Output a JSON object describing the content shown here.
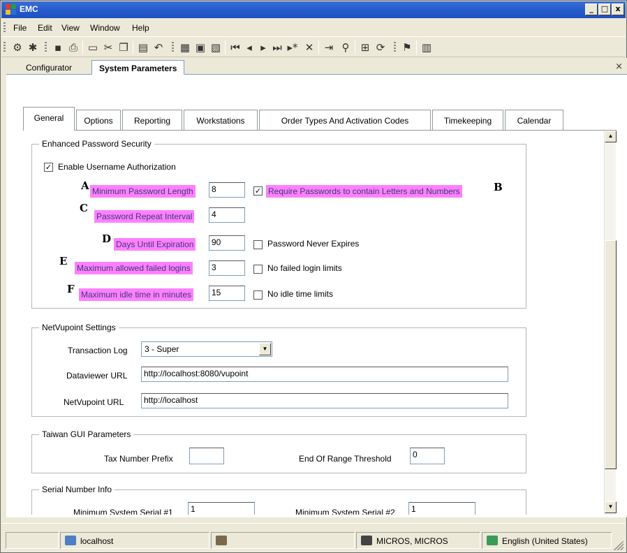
{
  "window": {
    "title": "EMC",
    "minimize": "_",
    "maximize": "□",
    "close": "x"
  },
  "menu": [
    "File",
    "Edit",
    "View",
    "Window",
    "Help"
  ],
  "toolbar_icons": [
    "module-icon",
    "modules-icon",
    "save-icon",
    "print-icon",
    "print-preview-icon",
    "cut-icon",
    "copy-icon",
    "paste-icon",
    "undo-icon",
    "form-view-icon",
    "table-view-icon",
    "duplicate-icon",
    "first-record-icon",
    "previous-record-icon",
    "next-record-icon",
    "last-record-icon",
    "new-record-icon",
    "delete-record-icon",
    "goto-icon",
    "find-icon",
    "tree-icon",
    "refresh-icon",
    "run-icon",
    "properties-icon"
  ],
  "doc_tabs": [
    "Configurator",
    "System Parameters"
  ],
  "doc_close": "×",
  "inner_tabs": [
    "General",
    "Options",
    "Reporting",
    "Workstations",
    "Order Types And Activation Codes",
    "Timekeeping",
    "Calendar"
  ],
  "password_security": {
    "title": "Enhanced Password Security",
    "enable_username": {
      "label": "Enable Username Authorization",
      "checked": true
    },
    "fields": [
      {
        "marker": "A",
        "label": "Minimum Password Length",
        "value": "8"
      },
      {
        "marker": "C",
        "label": "Password Repeat Interval",
        "value": "4"
      },
      {
        "marker": "D",
        "label": "Days Until Expiration",
        "value": "90"
      },
      {
        "marker": "E",
        "label": "Maximum allowed failed logins",
        "value": "3"
      },
      {
        "marker": "F",
        "label": "Maximum idle time in minutes",
        "value": "15"
      }
    ],
    "options": [
      {
        "marker": "B",
        "label": "Require Passwords to contain Letters and Numbers",
        "checked": true
      },
      {
        "label": "Password Never Expires",
        "checked": false
      },
      {
        "label": "No failed login limits",
        "checked": false
      },
      {
        "label": "No idle time limits",
        "checked": false
      }
    ]
  },
  "netvupoint": {
    "title": "NetVupoint Settings",
    "transaction_log_label": "Transaction Log",
    "transaction_log_value": "3 - Super",
    "dataviewer_label": "Dataviewer URL",
    "dataviewer_value": "http://localhost:8080/vupoint",
    "netvupoint_label": "NetVupoint URL",
    "netvupoint_value": "http://localhost"
  },
  "taiwan": {
    "title": "Taiwan GUI Parameters",
    "tax_prefix_label": "Tax Number Prefix",
    "tax_prefix_value": "",
    "threshold_label": "End Of Range Threshold",
    "threshold_value": "0"
  },
  "serial": {
    "title": "Serial Number Info",
    "serial1_label": "Minimum System Serial #1",
    "serial1_value": "1",
    "serial2_label": "Minimum System Serial #2",
    "serial2_value": "1"
  },
  "status": {
    "server": "localhost",
    "user": "MICROS, MICROS",
    "language": "English (United States)"
  },
  "colors": {
    "highlight": "#ff80ff",
    "titlebar": "#2a5fd0"
  }
}
